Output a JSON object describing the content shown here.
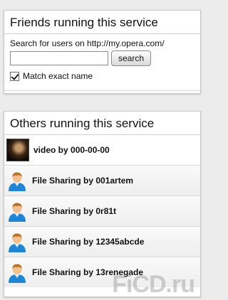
{
  "friends": {
    "title": "Friends running this service",
    "search_text": "Search for users on http://my.opera.com/",
    "search_value": "",
    "search_button": "search",
    "match_label": "Match exact name",
    "match_checked": true
  },
  "others": {
    "title": "Others running this service",
    "items": [
      {
        "label": "video by 000-00-00",
        "icon": "video-thumbnail"
      },
      {
        "label": "File Sharing by 001artem",
        "icon": "user-icon"
      },
      {
        "label": "File Sharing by 0r81t",
        "icon": "user-icon"
      },
      {
        "label": "File Sharing by 12345abcde",
        "icon": "user-icon"
      },
      {
        "label": "File Sharing by 13renegade",
        "icon": "user-icon"
      }
    ]
  },
  "watermark": "FiCD.ru"
}
